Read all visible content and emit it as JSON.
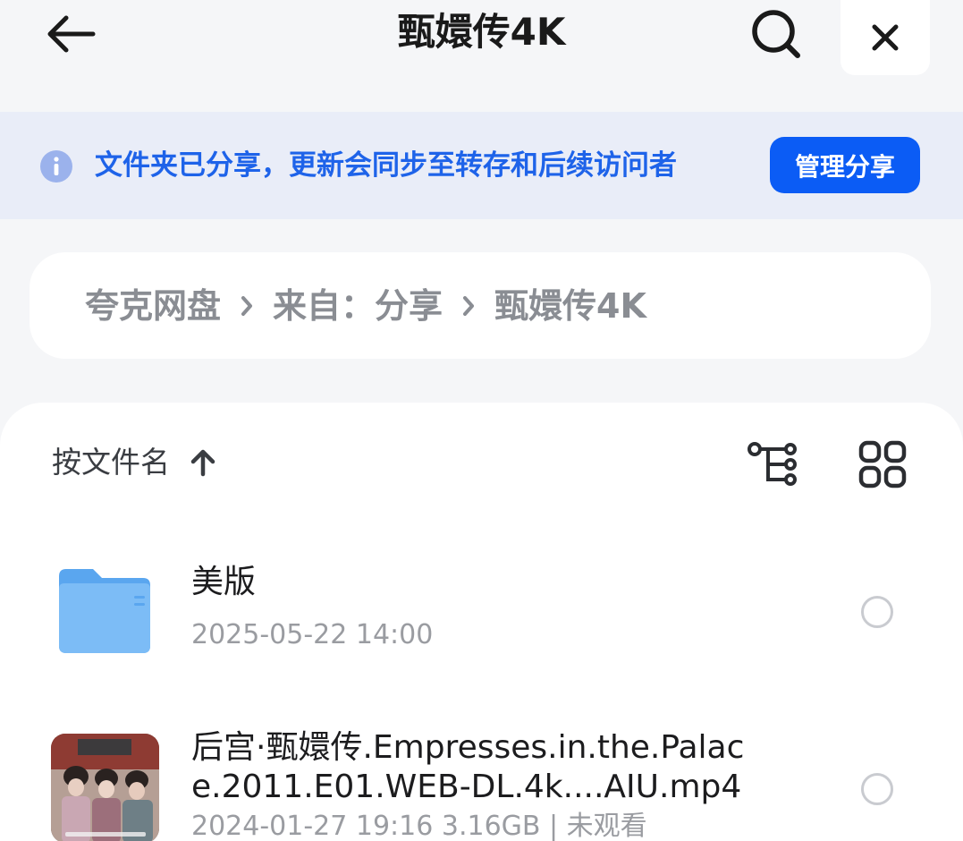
{
  "header": {
    "title": "甄嬛传4K",
    "back_icon": "arrow-left-icon",
    "search_icon": "search-icon",
    "close_icon": "close-icon"
  },
  "banner": {
    "info_icon": "info-icon",
    "text": "文件夹已分享，更新会同步至转存和后续访问者",
    "manage_label": "管理分享"
  },
  "breadcrumb": {
    "items": [
      "夸克网盘",
      "来自：分享",
      "甄嬛传4K"
    ]
  },
  "toolbar": {
    "sort_label": "按文件名",
    "sort_icon": "arrow-up-icon",
    "tree_icon": "tree-view-icon",
    "grid_icon": "grid-view-icon"
  },
  "files": [
    {
      "type": "folder",
      "icon": "folder-icon",
      "name": "美版",
      "meta": "2025-05-22 14:00"
    },
    {
      "type": "video",
      "icon": "video-thumbnail",
      "name": "后宫·甄嬛传.Empresses.in.the.Palace.2011.E01.WEB-DL.4k....AIU.mp4",
      "meta": "2024-01-27 19:16  3.16GB | 未观看"
    }
  ],
  "colors": {
    "accent": "#0b5cf5",
    "banner_bg": "#e9edf8",
    "banner_text": "#1e63e9",
    "page_bg": "#f5f6f8"
  }
}
